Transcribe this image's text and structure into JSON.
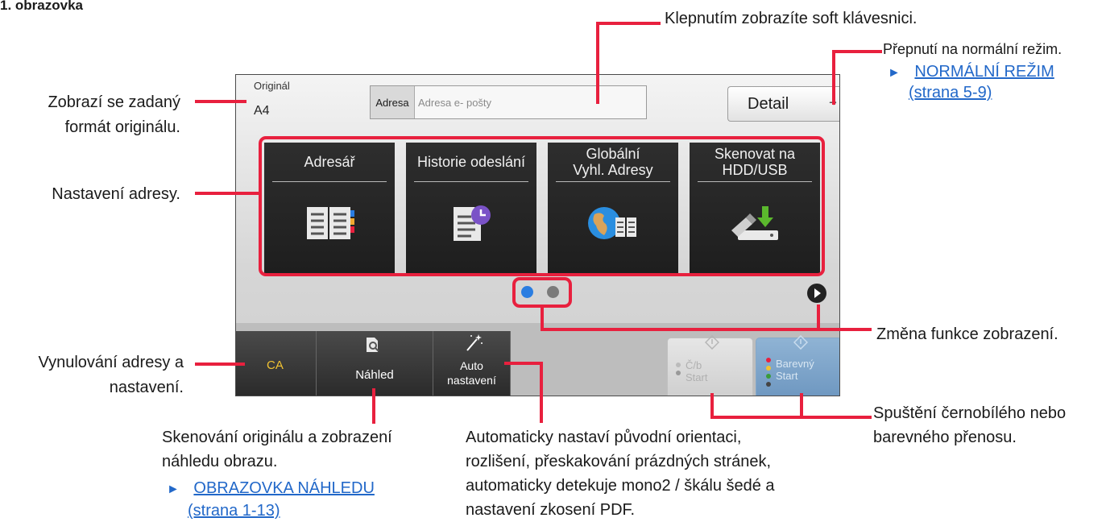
{
  "heading": "1. obrazovka",
  "callouts": {
    "soft_keyboard": "Klepnutím zobrazíte soft klávesnici.",
    "normal_mode": "Přepnutí na normální režim.",
    "normal_mode_link_1": "NORMÁLNÍ REŽIM",
    "normal_mode_link_2": "(strana 5-9)",
    "original_format_1": "Zobrazí se zadaný",
    "original_format_2": "formát originálu.",
    "address_setting": "Nastavení adresy.",
    "reset_1": "Vynulování adresy a",
    "reset_2": "nastavení.",
    "function_change": "Změna funkce zobrazení.",
    "preview_1": "Skenování originálu a zobrazení",
    "preview_2": "náhledu obrazu.",
    "preview_link_1": "OBRAZOVKA NÁHLEDU",
    "preview_link_2": "(strana 1-13)",
    "auto_1": "Automaticky nastaví původní orientaci,",
    "auto_2": "rozlišení, přeskakování prázdných stránek,",
    "auto_3": "automaticky detekuje mono2 / škálu šedé a",
    "auto_4": "nastavení zkosení PDF.",
    "start_1": "Spuštění černobílého nebo",
    "start_2": "barevného přenosu.",
    "arrow_glyph": "►"
  },
  "screen": {
    "original_label": "Originál",
    "original_value": "A4",
    "address_key": "Adresa",
    "address_placeholder": "Adresa e- pošty",
    "detail_button": "Detail",
    "tiles": [
      {
        "line1": "Adresář",
        "line2": "",
        "icon": "address-book-icon"
      },
      {
        "line1": "Historie odeslání",
        "line2": "",
        "icon": "send-history-icon"
      },
      {
        "line1": "Globální",
        "line2": "Vyhl. Adresy",
        "icon": "global-address-icon"
      },
      {
        "line1": "Skenovat na",
        "line2": "HDD/USB",
        "icon": "scan-to-usb-icon"
      }
    ],
    "page_dots": {
      "active_color": "#2a7de1",
      "inactive_color": "#7a7a7a"
    },
    "bottom": {
      "ca": "CA",
      "preview": "Náhled",
      "auto_1": "Auto",
      "auto_2": "nastavení",
      "bw_start_1": "Č/b",
      "bw_start_2": "Start",
      "color_start_1": "Barevný",
      "color_start_2": "Start"
    }
  },
  "colors": {
    "accent_red": "#e8203e",
    "ca_text": "#f1c232",
    "link_blue": "#2268c9"
  }
}
